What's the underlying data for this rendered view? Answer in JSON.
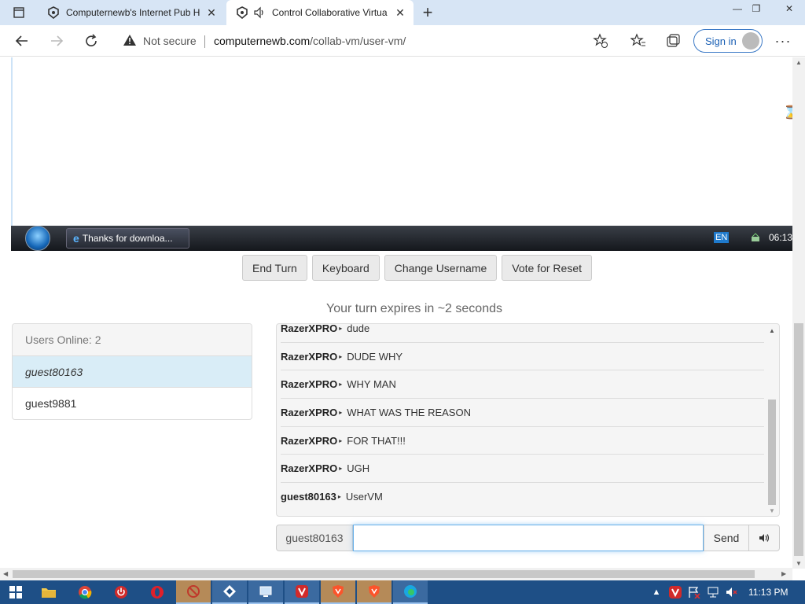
{
  "browser": {
    "tabs": [
      {
        "title": "Computernewb's Internet Pub H",
        "active": false
      },
      {
        "title": "Control Collaborative Virtua",
        "active": true
      }
    ],
    "address": {
      "security": "Not secure",
      "domain": "computernewb.com",
      "path": "/collab-vm/user-vm/"
    },
    "signin_label": "Sign in"
  },
  "vm": {
    "taskbar_item": "Thanks for downloa...",
    "lang": "EN",
    "clock": "06:13"
  },
  "controls": {
    "end_turn": "End Turn",
    "keyboard": "Keyboard",
    "change_username": "Change Username",
    "vote_reset": "Vote for Reset"
  },
  "turn_status": "Your turn expires in ~2 seconds",
  "users": {
    "header": "Users Online: 2",
    "list": [
      "guest80163",
      "guest9881"
    ]
  },
  "chat": {
    "messages": [
      {
        "user": "RazerXPRO",
        "text": "dude"
      },
      {
        "user": "RazerXPRO",
        "text": "DUDE WHY"
      },
      {
        "user": "RazerXPRO",
        "text": "WHY MAN"
      },
      {
        "user": "RazerXPRO",
        "text": "WHAT WAS THE REASON"
      },
      {
        "user": "RazerXPRO",
        "text": "FOR THAT!!!"
      },
      {
        "user": "RazerXPRO",
        "text": "UGH"
      },
      {
        "user": "guest80163",
        "text": "UserVM"
      }
    ],
    "username": "guest80163",
    "input_value": "",
    "send_label": "Send"
  },
  "taskbar": {
    "clock": "11:13 PM"
  }
}
